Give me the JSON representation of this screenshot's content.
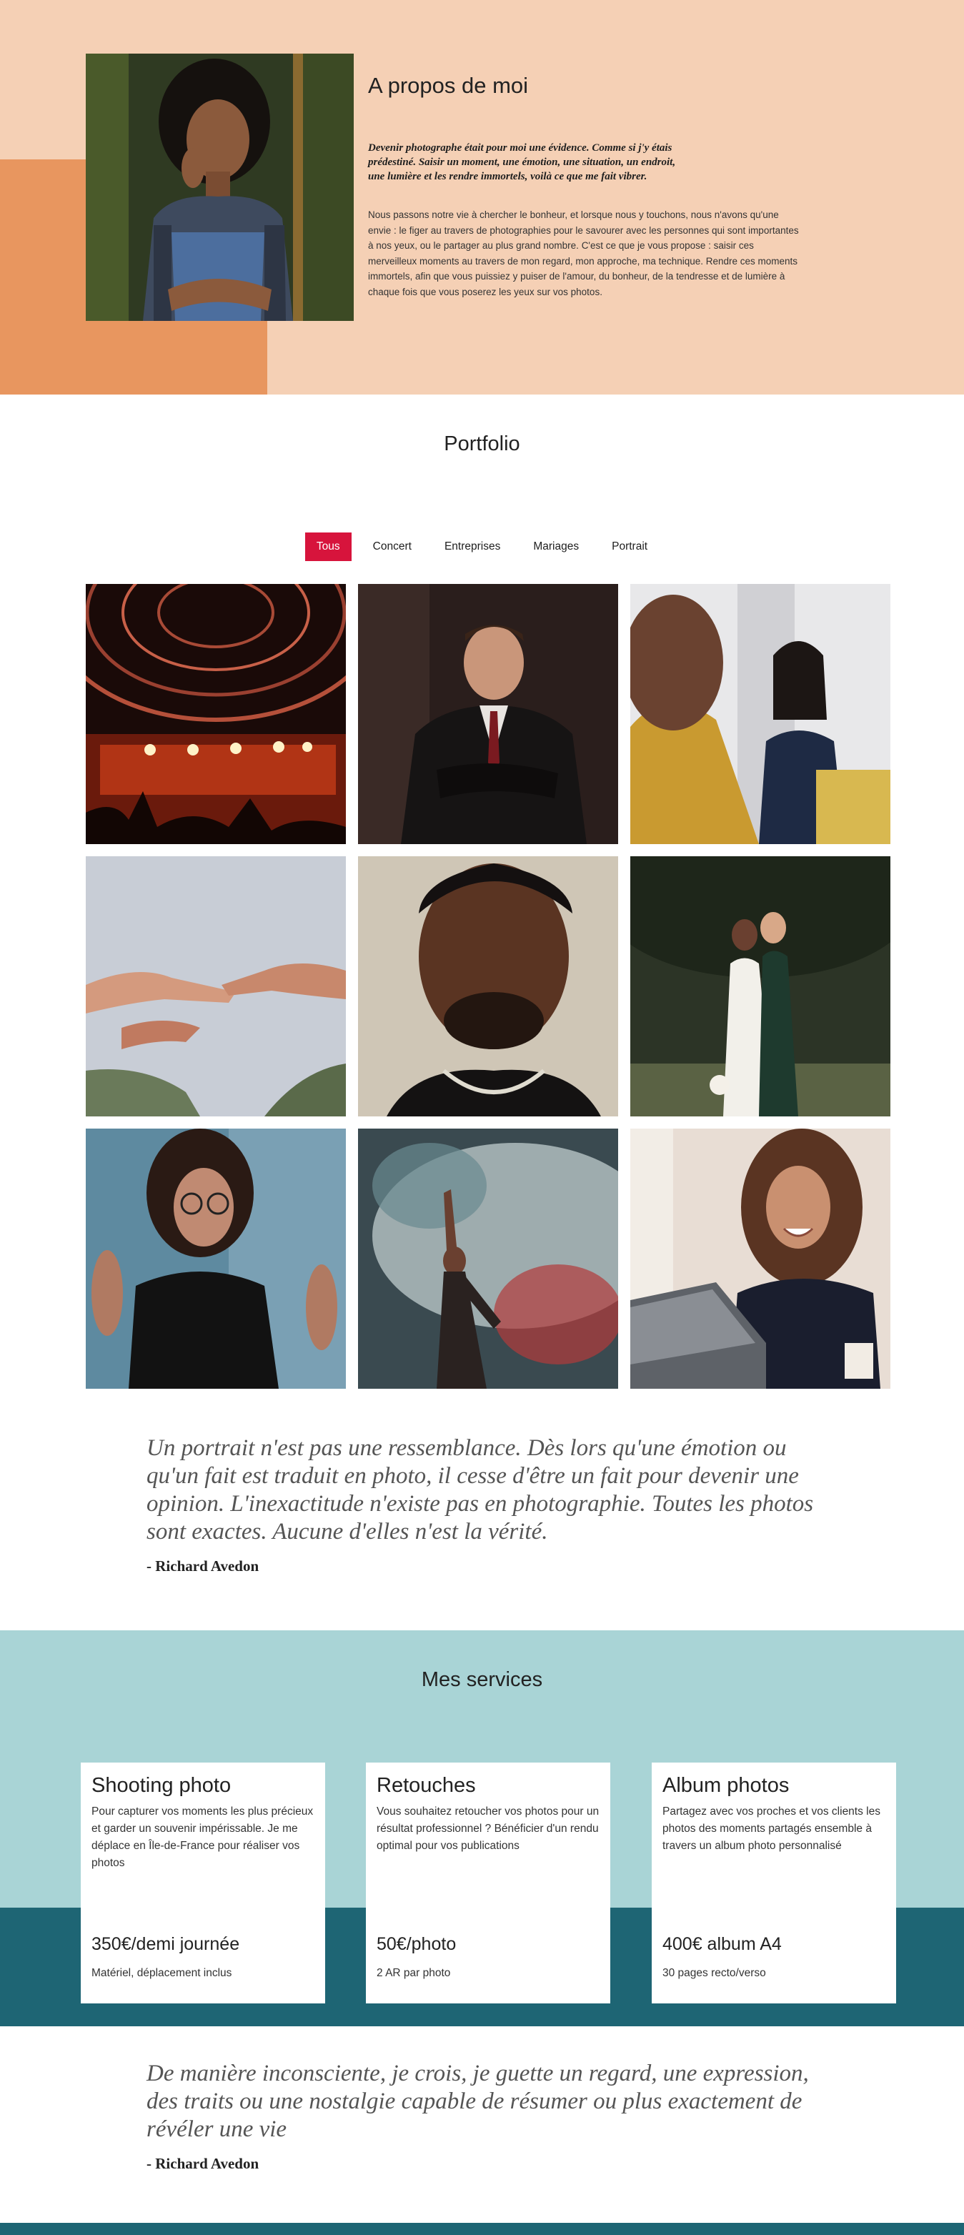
{
  "about": {
    "title": "A propos de moi",
    "lead": "Devenir photographe était pour moi une évidence. Comme si j'y étais prédestiné. Saisir un moment, une émotion, une situation, un endroit, une lumière et les rendre immortels, voilà ce que me fait vibrer.",
    "body": "Nous passons notre vie à chercher le bonheur, et lorsque nous y touchons, nous n'avons qu'une envie : le figer au travers de photographies pour le savourer avec les personnes qui sont importantes à nos yeux, ou le partager au plus grand nombre. C'est ce que je vous propose : saisir ces merveilleux moments au travers de mon regard, mon approche, ma technique. Rendre ces moments immortels, afin que vous puissiez y puiser de l'amour, du bonheur, de la tendresse et de lumière à chaque fois que vous poserez les yeux sur vos photos."
  },
  "portfolio": {
    "title": "Portfolio",
    "filters": [
      "Tous",
      "Concert",
      "Entreprises",
      "Mariages",
      "Portrait"
    ],
    "active_filter": "Tous"
  },
  "quotes": [
    {
      "text": "Un portrait n'est pas une ressemblance. Dès lors qu'une émotion ou qu'un fait est traduit en photo, il cesse d'être un fait pour devenir une opinion. L'inexactitude n'existe pas en photographie. Toutes les photos sont exactes. Aucune d'elles n'est la vérité.",
      "author": "- Richard Avedon"
    },
    {
      "text": "De manière inconsciente, je crois, je guette un regard, une expression, des traits ou une nostalgie capable de résumer ou plus exactement de révéler une vie",
      "author": "- Richard Avedon"
    }
  ],
  "services": {
    "title": "Mes services",
    "cards": [
      {
        "name": "Shooting photo",
        "desc": "Pour capturer vos moments les plus précieux et garder un souvenir impérissable. Je me déplace en Île-de-France pour réaliser vos photos",
        "price": "350€/demi journée",
        "note": "Matériel, déplacement inclus"
      },
      {
        "name": "Retouches",
        "desc": "Vous souhaitez retoucher vos photos pour un résultat professionnel ? Bénéficier d'un rendu optimal pour vos publications",
        "price": "50€/photo",
        "note": "2 AR par photo"
      },
      {
        "name": "Album photos",
        "desc": "Partagez avec vos proches et vos clients les photos des moments partagés ensemble à travers un album photo personnalisé",
        "price": "400€ album A4",
        "note": "30 pages recto/verso"
      }
    ]
  },
  "colors": {
    "about_bg": "#f5d0b5",
    "about_accent": "#e8965f",
    "filter_active": "#d7143c",
    "services_bg": "#a9d4d6",
    "services_band": "#1e6574"
  }
}
